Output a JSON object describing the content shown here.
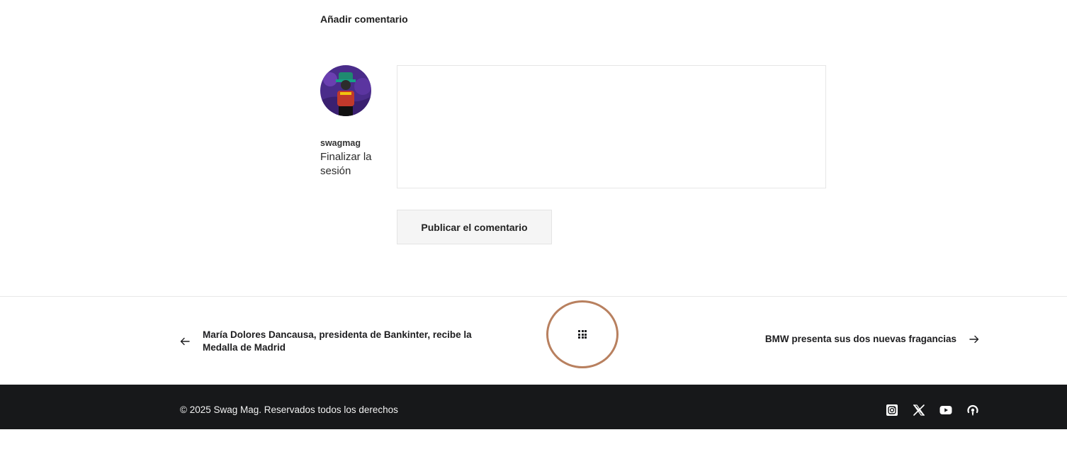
{
  "comment_form": {
    "heading": "Añadir comentario",
    "username": "swagmag",
    "logout_label": "Finalizar la sesión",
    "textarea_value": "",
    "submit_label": "Publicar el comentario"
  },
  "post_navigation": {
    "previous_title": "María Dolores Dancausa, presidenta de Bankinter, recibe la Medalla de Madrid",
    "next_title": "BMW presenta sus dos nuevas fragancias"
  },
  "footer": {
    "copyright": "© 2025 Swag Mag. Reservados todos los derechos",
    "social_icons": [
      "instagram-icon",
      "x-icon",
      "youtube-icon",
      "podcast-icon"
    ]
  },
  "colors": {
    "footer_background": "#17181a",
    "highlight_circle": "#b8805f",
    "button_background": "#f5f5f5"
  }
}
